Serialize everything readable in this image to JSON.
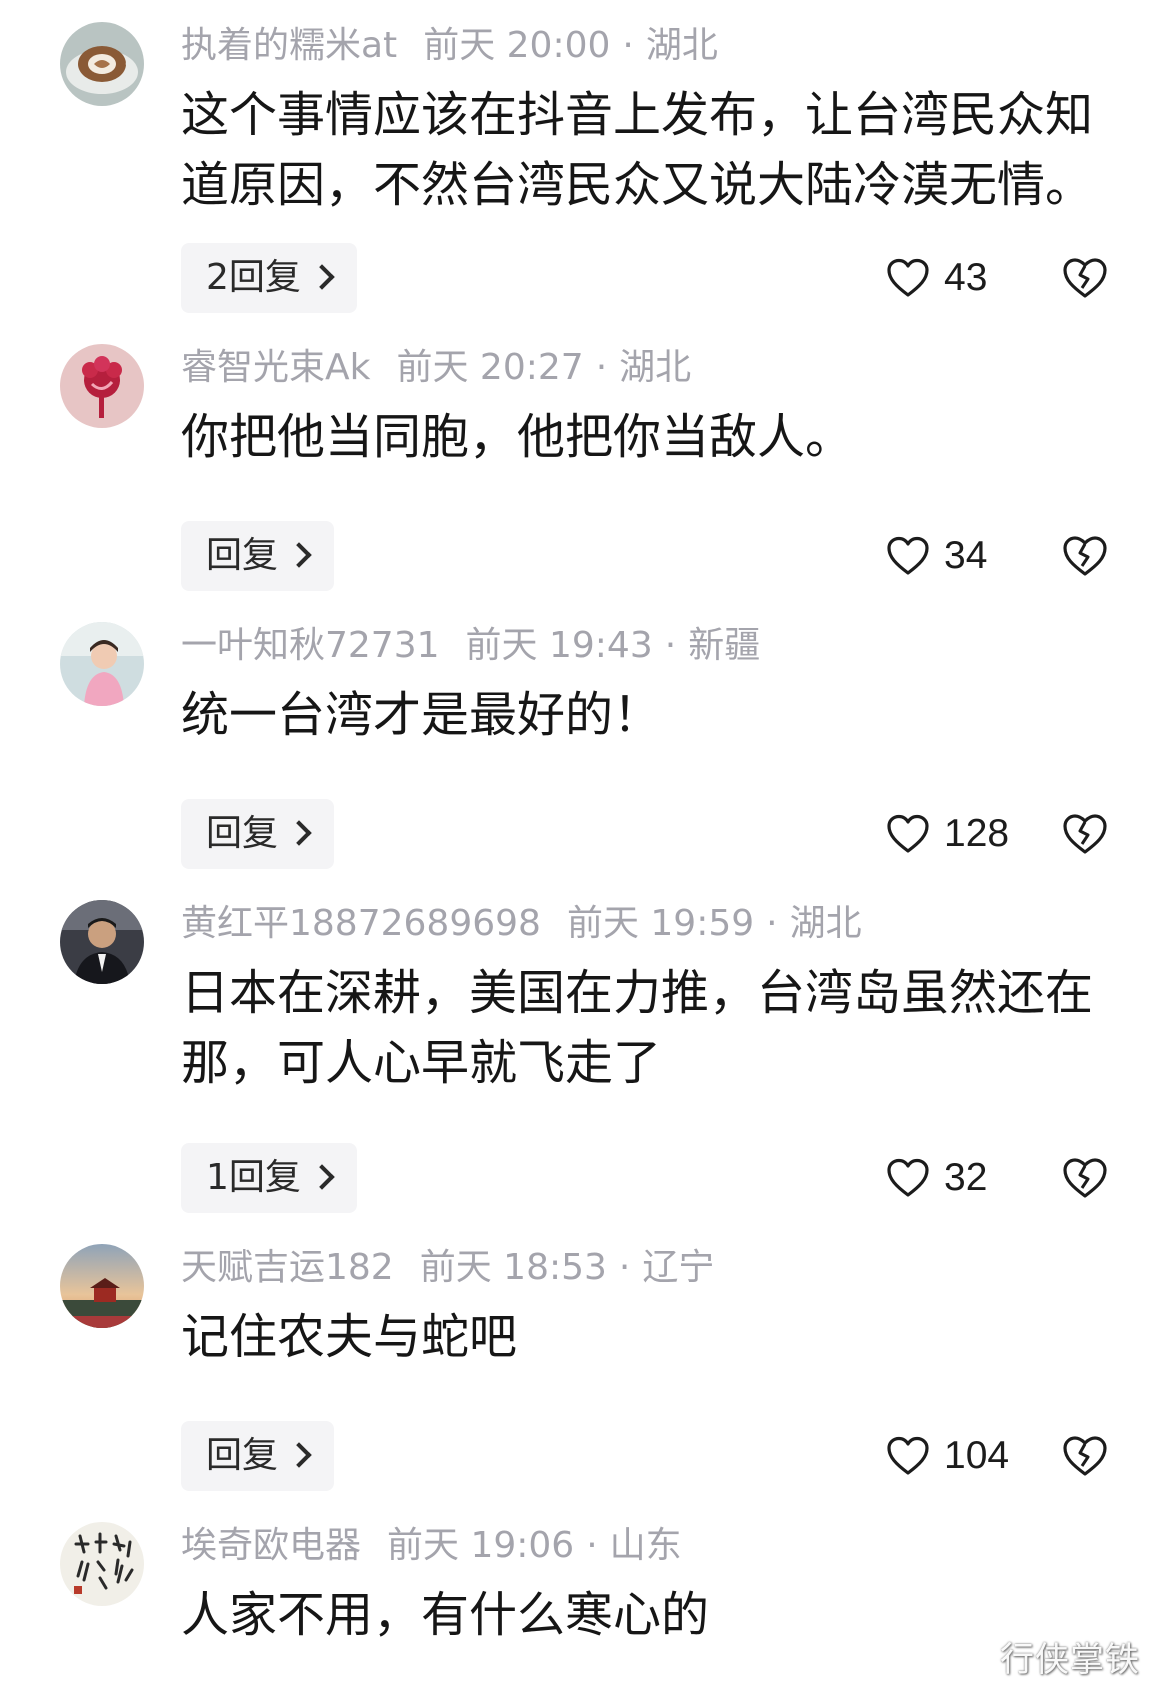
{
  "comments": [
    {
      "username": "执着的糯米at",
      "time": "前天 20:00",
      "dot": "·",
      "location": "湖北",
      "text": "这个事情应该在抖音上发布，让台湾民众知道原因，不然台湾民众又说大陆冷漠无情。",
      "reply_label": "2回复",
      "likes": "43",
      "avatar_icon": "coffee-latte-avatar"
    },
    {
      "username": "睿智光束Ak",
      "time": "前天 20:27",
      "dot": "·",
      "location": "湖北",
      "text": "你把他当同胞，他把你当敌人。",
      "reply_label": "回复",
      "likes": "34",
      "avatar_icon": "rose-flower-avatar"
    },
    {
      "username": "一叶知秋72731",
      "time": "前天 19:43",
      "dot": "·",
      "location": "新疆",
      "text": "统一台湾才是最好的！",
      "reply_label": "回复",
      "likes": "128",
      "avatar_icon": "child-photo-avatar"
    },
    {
      "username": "黄红平18872689698",
      "time": "前天 19:59",
      "dot": "·",
      "location": "湖北",
      "text": "日本在深耕，美国在力推，台湾岛虽然还在那，可人心早就飞走了",
      "reply_label": "1回复",
      "likes": "32",
      "avatar_icon": "man-portrait-avatar"
    },
    {
      "username": "天赋吉运182",
      "time": "前天 18:53",
      "dot": "·",
      "location": "辽宁",
      "text": "记住农夫与蛇吧",
      "reply_label": "回复",
      "likes": "104",
      "avatar_icon": "sunset-landscape-avatar"
    },
    {
      "username": "埃奇欧电器",
      "time": "前天 19:06",
      "dot": "·",
      "location": "山东",
      "text": "人家不用，有什么寒心的",
      "avatar_icon": "calligraphy-avatar"
    }
  ],
  "watermark": "行侠掌铁",
  "icons": {
    "like": "heart-outline-icon",
    "dislike": "broken-heart-icon",
    "reply_arrow": "chevron-right-icon"
  },
  "colors": {
    "text": "#161616",
    "meta": "#a4a4ac",
    "reply_bg": "#f4f4f6"
  }
}
